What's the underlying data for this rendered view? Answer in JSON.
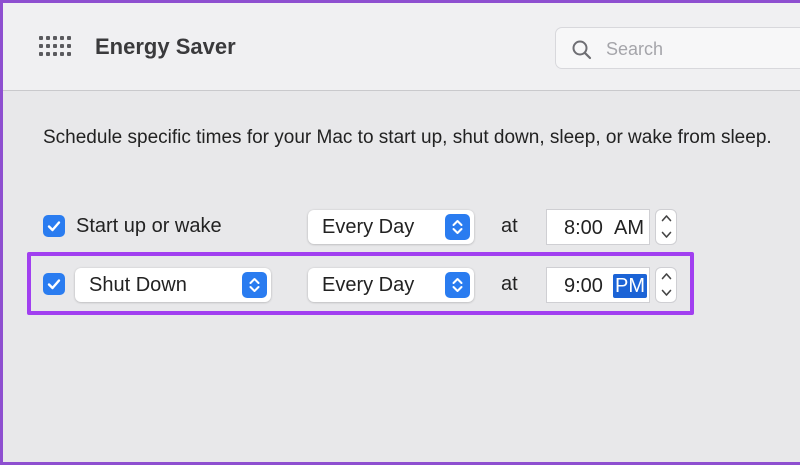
{
  "window": {
    "title": "Energy Saver",
    "grid_icon": "grid-icon"
  },
  "search": {
    "placeholder": "Search",
    "value": ""
  },
  "description": "Schedule specific times for your Mac to start up, shut down, sleep, or wake from sleep.",
  "schedule": {
    "startup": {
      "checked": true,
      "label": "Start up or wake",
      "frequency": "Every Day",
      "at_label": "at",
      "time": "8:00",
      "ampm": "AM"
    },
    "shutdown": {
      "checked": true,
      "action": "Shut Down",
      "frequency": "Every Day",
      "at_label": "at",
      "time": "9:00",
      "ampm": "PM",
      "ampm_selected": true
    }
  },
  "colors": {
    "accent": "#2a7cf0",
    "highlight": "#a13ff0",
    "selection": "#1b63d6"
  }
}
